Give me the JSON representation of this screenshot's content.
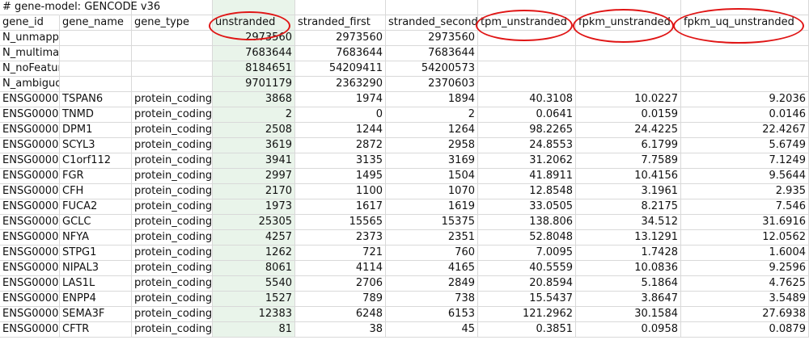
{
  "title_row": [
    "# gene-model: GENCODE v36",
    "",
    "",
    "",
    "",
    "",
    "",
    "",
    ""
  ],
  "header_row": [
    "gene_id",
    "gene_name",
    "gene_type",
    "unstranded",
    "stranded_first",
    "stranded_second",
    "tpm_unstranded",
    "fpkm_unstranded",
    "fpkm_uq_unstranded"
  ],
  "data_rows": [
    [
      "N_unmapped",
      "",
      "",
      "2973560",
      "2973560",
      "2973560",
      "",
      "",
      ""
    ],
    [
      "N_multimapping",
      "",
      "",
      "7683644",
      "7683644",
      "7683644",
      "",
      "",
      ""
    ],
    [
      "N_noFeature",
      "",
      "",
      "8184651",
      "54209411",
      "54200573",
      "",
      "",
      ""
    ],
    [
      "N_ambiguous",
      "",
      "",
      "9701179",
      "2363290",
      "2370603",
      "",
      "",
      ""
    ],
    [
      "ENSG0000",
      "TSPAN6",
      "protein_coding",
      "3868",
      "1974",
      "1894",
      "40.3108",
      "10.0227",
      "9.2036"
    ],
    [
      "ENSG0000",
      "TNMD",
      "protein_coding",
      "2",
      "0",
      "2",
      "0.0641",
      "0.0159",
      "0.0146"
    ],
    [
      "ENSG0000",
      "DPM1",
      "protein_coding",
      "2508",
      "1244",
      "1264",
      "98.2265",
      "24.4225",
      "22.4267"
    ],
    [
      "ENSG0000",
      "SCYL3",
      "protein_coding",
      "3619",
      "2872",
      "2958",
      "24.8553",
      "6.1799",
      "5.6749"
    ],
    [
      "ENSG0000",
      "C1orf112",
      "protein_coding",
      "3941",
      "3135",
      "3169",
      "31.2062",
      "7.7589",
      "7.1249"
    ],
    [
      "ENSG0000",
      "FGR",
      "protein_coding",
      "2997",
      "1495",
      "1504",
      "41.8911",
      "10.4156",
      "9.5644"
    ],
    [
      "ENSG0000",
      "CFH",
      "protein_coding",
      "2170",
      "1100",
      "1070",
      "12.8548",
      "3.1961",
      "2.935"
    ],
    [
      "ENSG0000",
      "FUCA2",
      "protein_coding",
      "1973",
      "1617",
      "1619",
      "33.0505",
      "8.2175",
      "7.546"
    ],
    [
      "ENSG0000",
      "GCLC",
      "protein_coding",
      "25305",
      "15565",
      "15375",
      "138.806",
      "34.512",
      "31.6916"
    ],
    [
      "ENSG0000",
      "NFYA",
      "protein_coding",
      "4257",
      "2373",
      "2351",
      "52.8048",
      "13.1291",
      "12.0562"
    ],
    [
      "ENSG0000",
      "STPG1",
      "protein_coding",
      "1262",
      "721",
      "760",
      "7.0095",
      "1.7428",
      "1.6004"
    ],
    [
      "ENSG0000",
      "NIPAL3",
      "protein_coding",
      "8061",
      "4114",
      "4165",
      "40.5559",
      "10.0836",
      "9.2596"
    ],
    [
      "ENSG0000",
      "LAS1L",
      "protein_coding",
      "5540",
      "2706",
      "2849",
      "20.8594",
      "5.1864",
      "4.7625"
    ],
    [
      "ENSG0000",
      "ENPP4",
      "protein_coding",
      "1527",
      "789",
      "738",
      "15.5437",
      "3.8647",
      "3.5489"
    ],
    [
      "ENSG0000",
      "SEMA3F",
      "protein_coding",
      "12383",
      "6248",
      "6153",
      "121.2962",
      "30.1584",
      "27.6938"
    ],
    [
      "ENSG0000",
      "CFTR",
      "protein_coding",
      "81",
      "38",
      "45",
      "0.3851",
      "0.0958",
      "0.0879"
    ]
  ],
  "highlighted_headers": [
    "unstranded",
    "tpm_unstranded",
    "fpkm_unstranded",
    "fpkm_uq_unstranded"
  ],
  "colors": {
    "annotation_circle": "#e01515",
    "selected_column": "#e9f4ea",
    "gridline": "#d9d9d9"
  }
}
